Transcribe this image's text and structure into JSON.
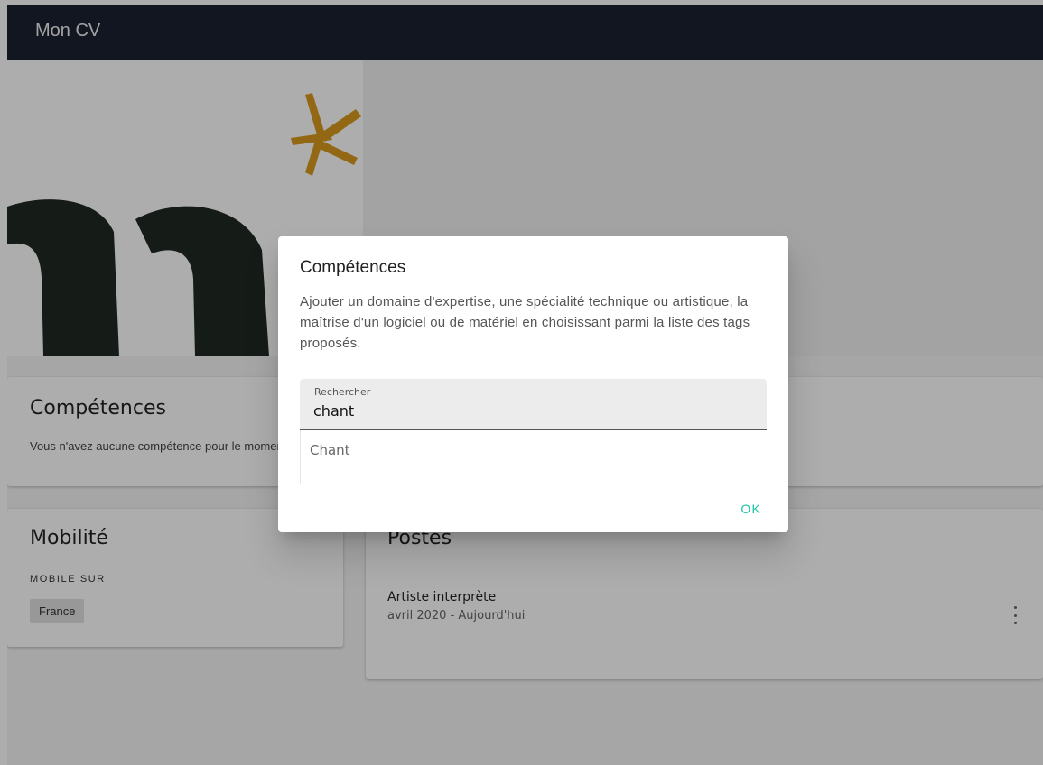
{
  "app": {
    "title": "Mon CV"
  },
  "skills_card": {
    "title": "Compétences",
    "empty_text": "Vous n'avez aucune compétence pour le moment"
  },
  "mobility_card": {
    "title": "Mobilité",
    "overline": "MOBILE SUR",
    "chip": "France"
  },
  "positions_card": {
    "title": "Postes",
    "items": [
      {
        "title": "Artiste interprète",
        "dates": "avril 2020 - Aujourd'hui"
      }
    ]
  },
  "dialog": {
    "title": "Compétences",
    "description": "Ajouter un domaine d'expertise, une spécialité technique ou artistique, la maîtrise d'un logiciel ou de matériel en choisissant parmi la liste des tags proposés.",
    "search_label": "Rechercher",
    "search_value": "chant",
    "options": [
      "Chant",
      "Chant mezzo"
    ],
    "ok_label": "OK"
  },
  "colors": {
    "appbar": "#1a2130",
    "accent": "#19c6a6",
    "logo_dark": "#1f2a22",
    "logo_gold": "#d99a1f"
  }
}
